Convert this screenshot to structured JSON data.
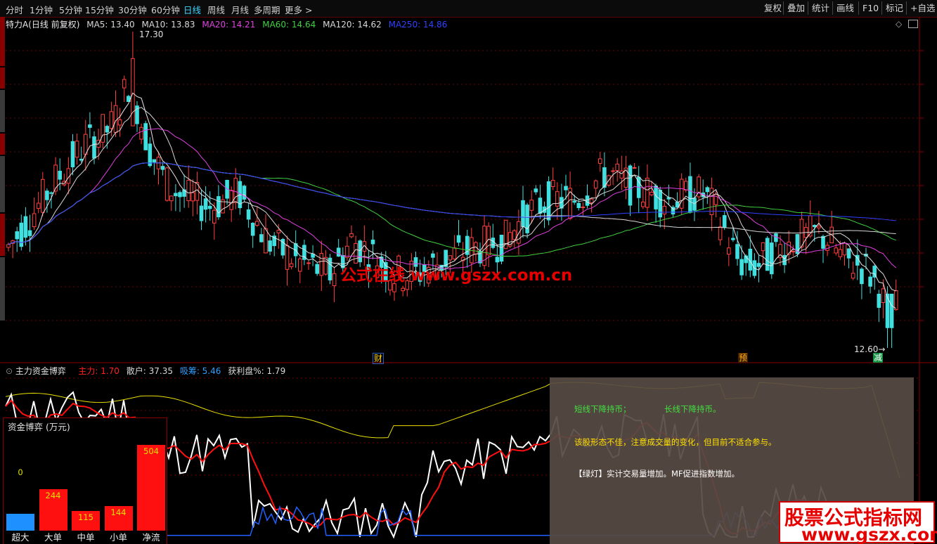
{
  "toolbar": {
    "periods": [
      "分时",
      "1分钟",
      "5分钟",
      "15分钟",
      "30分钟",
      "60分钟",
      "日线",
      "周线",
      "月线",
      "多周期",
      "更多 >"
    ],
    "active_index": 6,
    "right_tools": [
      "复权",
      "叠加",
      "统计",
      "画线",
      "F10",
      "标记",
      "+自选"
    ]
  },
  "main_legend": {
    "stock_title": "特力A(日线 前复权)",
    "items": [
      {
        "label": "MA5: 13.40",
        "color": "#d8d8d8"
      },
      {
        "label": "MA10: 13.83",
        "color": "#d8d8d8"
      },
      {
        "label": "MA20: 14.21",
        "color": "#e040e0"
      },
      {
        "label": "MA60: 14.64",
        "color": "#40d040"
      },
      {
        "label": "MA120: 14.62",
        "color": "#d8d8d8"
      },
      {
        "label": "MA250: 14.86",
        "color": "#3040ff"
      }
    ]
  },
  "annotations": {
    "high_label": "17.30",
    "low_label": "12.60→",
    "marks": [
      {
        "text": "财",
        "x": 537
      },
      {
        "text": "预",
        "x": 1057
      },
      {
        "text": "减",
        "x": 1249
      }
    ]
  },
  "watermark": "公式在线   www.gszx.com.cn",
  "sub_legend": {
    "title": "主力资金博弈",
    "items": [
      {
        "label": "主力: 1.70",
        "color": "#ff2020"
      },
      {
        "label": "散户: 37.35",
        "color": "#d8d8d8"
      },
      {
        "label": "吸筹: 5.46",
        "color": "#30a0ff"
      },
      {
        "label": "获利盘%: 1.79",
        "color": "#d8d8d8"
      }
    ]
  },
  "fund_panel": {
    "title": "资金博弈 (万元)",
    "bars": [
      {
        "category": "超大",
        "value": 0,
        "label": "0",
        "color": "#1e90ff"
      },
      {
        "category": "大单",
        "value": 244,
        "label": "244",
        "color": "#ff1010"
      },
      {
        "category": "中单",
        "value": 115,
        "label": "115",
        "color": "#ff1010"
      },
      {
        "category": "小单",
        "value": 144,
        "label": "144",
        "color": "#ff1010"
      },
      {
        "category": "净流",
        "value": 504,
        "label": "504",
        "color": "#ff1010"
      }
    ]
  },
  "info_box": {
    "line1a": "短线下降持币；",
    "line1b": "长线下降持币。",
    "line2": "该股形态不佳，注意成交量的变化，但目前不适合参与。",
    "line3": "【绿灯】实计交易量增加。MF促进指数增加。"
  },
  "brand": {
    "line1": "股票公式指标网",
    "line2": "www.gszx.com.cn"
  },
  "chart_data": {
    "type": "line",
    "price_range": [
      12.6,
      17.3
    ],
    "series": [
      {
        "name": "MA5",
        "values": []
      },
      {
        "name": "MA10",
        "values": []
      },
      {
        "name": "MA20",
        "values": []
      },
      {
        "name": "MA60",
        "values": []
      },
      {
        "name": "MA120",
        "values": []
      },
      {
        "name": "MA250",
        "values": []
      }
    ],
    "candles_ohlc_sample": [
      [
        14.0,
        14.3,
        13.9,
        14.2
      ],
      [
        14.2,
        14.6,
        14.1,
        14.5
      ],
      [
        14.6,
        15.2,
        14.5,
        15.1
      ],
      [
        15.5,
        17.3,
        15.4,
        17.0
      ],
      [
        16.4,
        16.6,
        15.5,
        15.8
      ],
      [
        15.0,
        15.3,
        14.2,
        14.4
      ],
      [
        14.1,
        14.3,
        13.6,
        13.8
      ],
      [
        13.8,
        14.1,
        13.5,
        13.9
      ],
      [
        14.2,
        15.7,
        14.1,
        15.4
      ],
      [
        15.2,
        15.4,
        14.8,
        15.0
      ],
      [
        14.9,
        15.3,
        14.7,
        15.1
      ],
      [
        14.2,
        14.4,
        13.8,
        13.9
      ],
      [
        14.0,
        14.5,
        13.9,
        14.4
      ],
      [
        14.3,
        14.7,
        14.2,
        14.6
      ],
      [
        13.8,
        14.0,
        13.4,
        13.5
      ],
      [
        13.4,
        13.6,
        12.7,
        12.9
      ],
      [
        13.2,
        13.5,
        12.9,
        13.4
      ]
    ],
    "sub_range": [
      0,
      100
    ],
    "sub_series": [
      {
        "name": "主力",
        "values": []
      },
      {
        "name": "散户",
        "values": []
      },
      {
        "name": "吸筹",
        "values": []
      },
      {
        "name": "获利盘%",
        "values": []
      }
    ]
  }
}
